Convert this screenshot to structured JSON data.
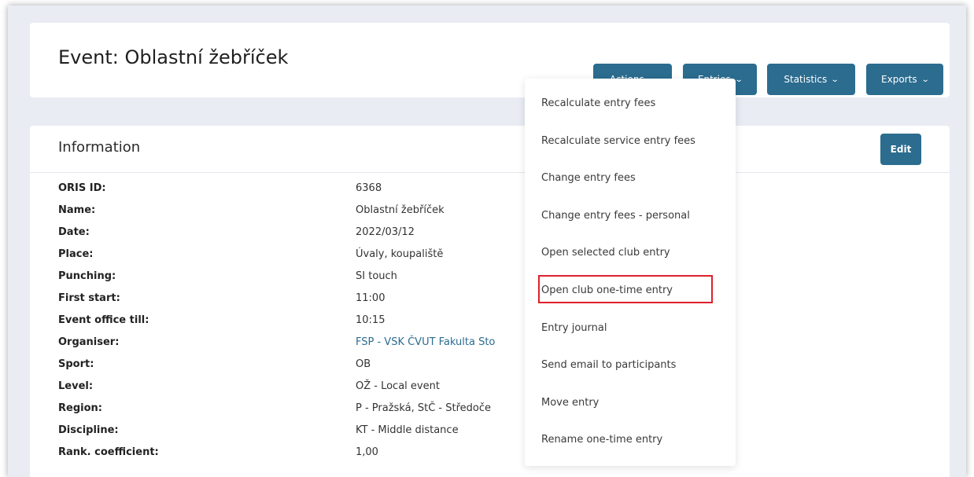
{
  "header": {
    "title": "Event: Oblastní žebříček",
    "buttons": {
      "actions": "Actions",
      "entries": "Entries",
      "statistics": "Statistics",
      "exports": "Exports"
    }
  },
  "info": {
    "title": "Information",
    "edit_label": "Edit",
    "rows": [
      {
        "label": "ORIS ID:",
        "value": "6368"
      },
      {
        "label": "Name:",
        "value": "Oblastní žebříček"
      },
      {
        "label": "Date:",
        "value": "2022/03/12"
      },
      {
        "label": "Place:",
        "value": "Úvaly, koupaliště"
      },
      {
        "label": "Punching:",
        "value": "SI touch"
      },
      {
        "label": "First start:",
        "value": "11:00"
      },
      {
        "label": "Event office till:",
        "value": "10:15"
      },
      {
        "label": "Organiser:",
        "value": "FSP - VSK ČVUT Fakulta Sto"
      },
      {
        "label": "Sport:",
        "value": "OB"
      },
      {
        "label": "Level:",
        "value": "OŽ - Local event"
      },
      {
        "label": "Region:",
        "value": "P - Pražská, StČ - Středoče"
      },
      {
        "label": "Discipline:",
        "value": "KT - Middle distance"
      },
      {
        "label": "Rank. coefficient:",
        "value": "1,00"
      }
    ]
  },
  "entries_menu": {
    "items": [
      "Recalculate entry fees",
      "Recalculate service entry fees",
      "Change entry fees",
      "Change entry fees - personal",
      "Open selected club entry",
      "Open club one-time entry",
      "Entry journal",
      "Send email to participants",
      "Move entry",
      "Rename one-time entry"
    ],
    "highlighted_index": 5
  },
  "colors": {
    "accent": "#2b6c8f",
    "highlight": "#e0202a",
    "background": "#e9ecf3"
  }
}
